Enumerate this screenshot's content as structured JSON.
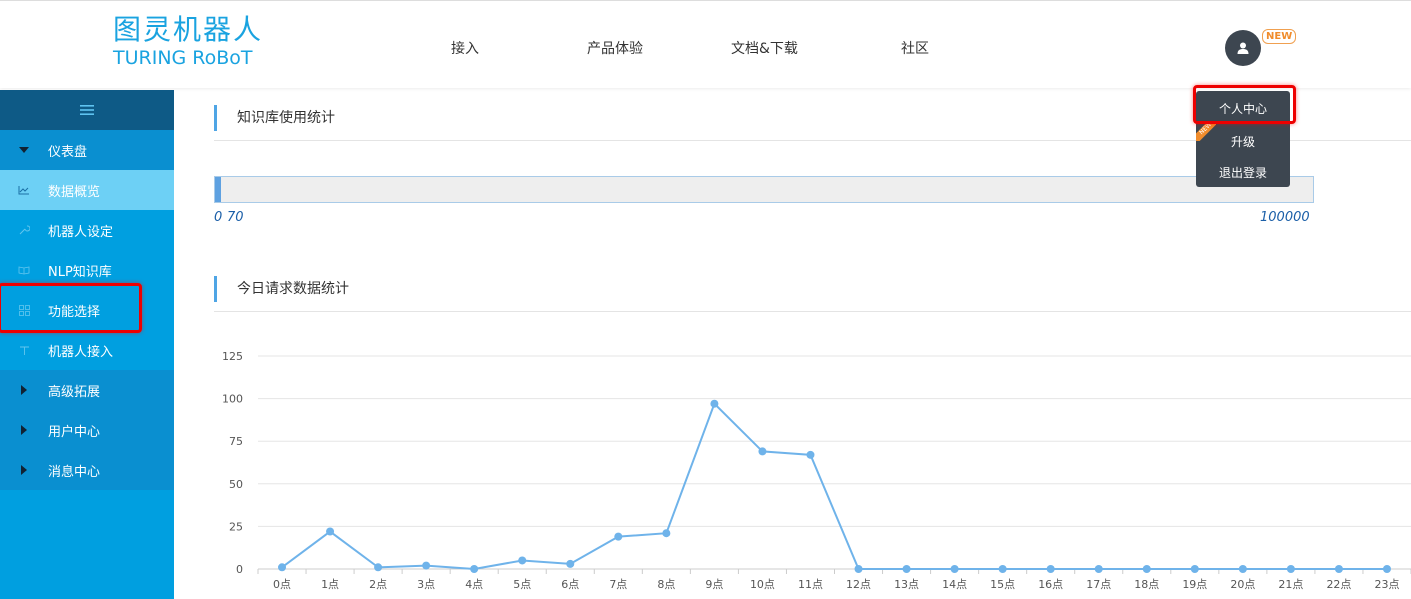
{
  "header": {
    "logo_cn": "图灵机器人",
    "logo_en": "TURING RoBoT",
    "nav": [
      "接入",
      "产品体验",
      "文档&下载",
      "社区"
    ],
    "new_badge": "NEW"
  },
  "user_menu": {
    "items": [
      "个人中心",
      "升级",
      "退出登录"
    ],
    "ribbon": "NEW"
  },
  "sidebar": {
    "items": [
      {
        "label": "仪表盘",
        "icon": "caret-down-icon"
      },
      {
        "label": "数据概览",
        "icon": "line-chart-icon"
      },
      {
        "label": "机器人设定",
        "icon": "wrench-icon"
      },
      {
        "label": "NLP知识库",
        "icon": "book-icon"
      },
      {
        "label": "功能选择",
        "icon": "grid-icon"
      },
      {
        "label": "机器人接入",
        "icon": "plug-icon"
      },
      {
        "label": "高级拓展",
        "icon": "caret-right-icon"
      },
      {
        "label": "用户中心",
        "icon": "caret-right-icon"
      },
      {
        "label": "消息中心",
        "icon": "caret-right-icon"
      }
    ]
  },
  "knowledge": {
    "title": "知识库使用统计",
    "used": 70,
    "max": 100000,
    "min_label": "0",
    "used_label": "70",
    "max_label": "100000"
  },
  "requests": {
    "title": "今日请求数据统计"
  },
  "colors": {
    "accent": "#009fe0",
    "line": "#6fb3ea",
    "highlight": "#ee0000"
  },
  "chart_data": {
    "type": "line",
    "categories": [
      "0点",
      "1点",
      "2点",
      "3点",
      "4点",
      "5点",
      "6点",
      "7点",
      "8点",
      "9点",
      "10点",
      "11点",
      "12点",
      "13点",
      "14点",
      "15点",
      "16点",
      "17点",
      "18点",
      "19点",
      "20点",
      "21点",
      "22点",
      "23点"
    ],
    "series": [
      {
        "values": [
          1,
          22,
          1,
          2,
          0,
          5,
          3,
          19,
          21,
          97,
          69,
          67,
          0,
          0,
          0,
          0,
          0,
          0,
          0,
          0,
          0,
          0,
          0,
          0
        ]
      }
    ],
    "yticks": [
      0,
      25,
      50,
      75,
      100,
      125
    ],
    "ylim": [
      0,
      125
    ],
    "grid": true
  }
}
